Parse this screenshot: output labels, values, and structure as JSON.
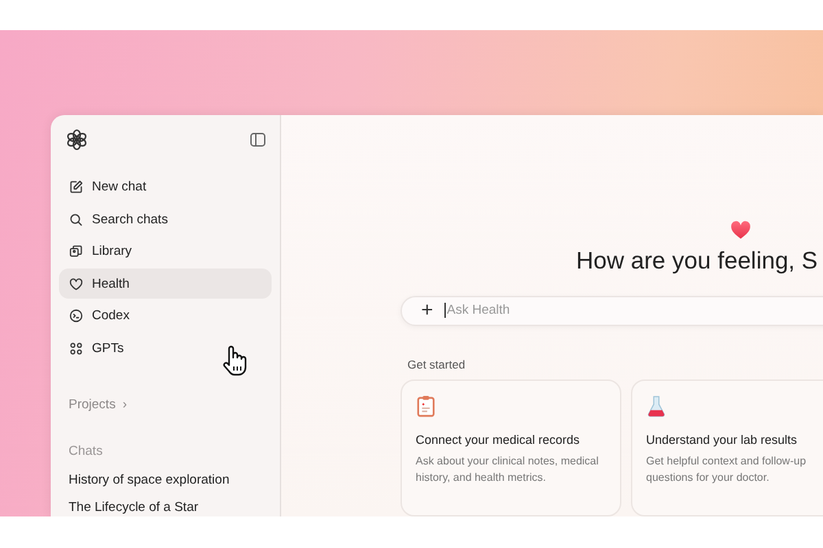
{
  "sidebar": {
    "items": [
      {
        "kind": "new",
        "label": "New chat",
        "selected": false
      },
      {
        "kind": "search",
        "label": "Search chats",
        "selected": false
      },
      {
        "kind": "library",
        "label": "Library",
        "selected": false
      },
      {
        "kind": "health",
        "label": "Health",
        "selected": true
      },
      {
        "kind": "codex",
        "label": "Codex",
        "selected": false
      },
      {
        "kind": "gpts",
        "label": "GPTs",
        "selected": false
      }
    ],
    "projects": {
      "label": "Projects",
      "chevron": "›"
    },
    "chats_heading": "Chats",
    "chats": [
      "History of space exploration",
      "The Lifecycle of a Star"
    ]
  },
  "main": {
    "heading": "How are you feeling, S",
    "composer": {
      "plus": "+",
      "placeholder": "Ask Health"
    },
    "section_heading": "Get started",
    "cards": [
      {
        "kind": "records",
        "title": "Connect your medical records",
        "description": "Ask about your clinical notes, medical history, and health metrics."
      },
      {
        "kind": "lab",
        "title": "Understand your lab results",
        "description": "Get helpful context and follow-up questions for your doctor."
      }
    ]
  }
}
